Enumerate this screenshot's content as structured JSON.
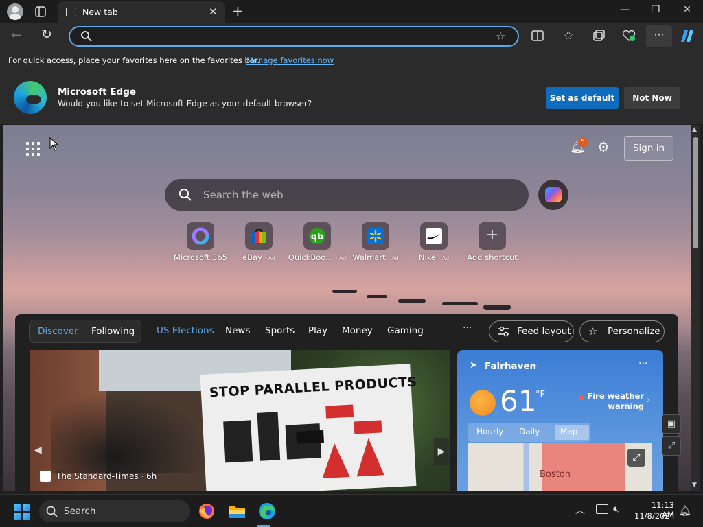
{
  "tab": {
    "title": "New tab"
  },
  "window": {
    "minimize": "—",
    "maximize": "❐",
    "close": "✕"
  },
  "favorites_bar": {
    "text": "For quick access, place your favorites here on the favorites bar.",
    "link": "Manage favorites now"
  },
  "default_prompt": {
    "title": "Microsoft Edge",
    "subtitle": "Would you like to set Microsoft Edge as your default browser?",
    "primary": "Set as default",
    "secondary": "Not Now"
  },
  "newtab": {
    "notification_count": "5",
    "signin": "Sign in",
    "search_placeholder": "Search the web",
    "quick_links": [
      {
        "label": "Microsoft 365",
        "ad": ""
      },
      {
        "label": "eBay",
        "ad": "· Ad"
      },
      {
        "label": "QuickBoo...",
        "ad": "· Ad"
      },
      {
        "label": "Walmart",
        "ad": "· Ad"
      },
      {
        "label": "Nike",
        "ad": "· Ad"
      },
      {
        "label": "Add shortcut",
        "ad": ""
      }
    ]
  },
  "feed": {
    "pivots": [
      "Discover",
      "Following",
      "US Elections",
      "News",
      "Sports",
      "Play",
      "Money",
      "Gaming"
    ],
    "more": "···",
    "feed_layout": "Feed layout",
    "personalize": "Personalize",
    "hero": {
      "sign_text": "STOP PARALLEL PRODUCTS",
      "source": "The Standard-Times",
      "age": "· 6h"
    },
    "weather": {
      "location": "Fairhaven",
      "temp": "61",
      "unit": "°F",
      "alert": "Fire weather warning",
      "tabs": [
        "Hourly",
        "Daily",
        "Map"
      ],
      "map_city": "Boston"
    }
  },
  "taskbar": {
    "search": "Search",
    "time": "11:13 AM",
    "date": "11/8/2024"
  },
  "colors": {
    "accent": "#0f6cbd",
    "link": "#64b5f6",
    "discover": "#5ea7e8"
  }
}
